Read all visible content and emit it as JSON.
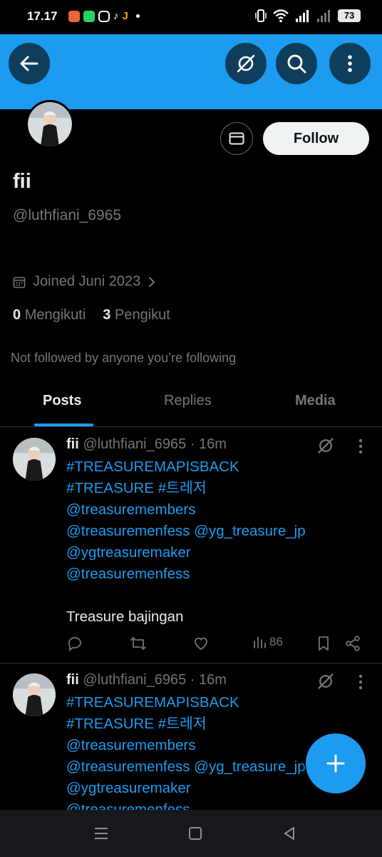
{
  "status_bar": {
    "time": "17.17",
    "battery": "73",
    "app_icon_colors": [
      "#e8663a",
      "#25d366",
      "#ffffff",
      "#ffffff",
      "#f5a623"
    ]
  },
  "profile": {
    "display_name": "fii",
    "handle": "@luthfiani_6965",
    "joined": "Joined Juni 2023",
    "following_count": "0",
    "following_label": "Mengikuti",
    "followers_count": "3",
    "followers_label": "Pengikut",
    "not_followed_text": "Not followed by anyone you’re following",
    "follow_label": "Follow"
  },
  "tabs": [
    {
      "label": "Posts",
      "active": true
    },
    {
      "label": "Replies",
      "active": false
    },
    {
      "label": "Media",
      "active": false
    }
  ],
  "posts": [
    {
      "name": "fii",
      "meta": "@luthfiani_6965 · 16m",
      "lines": [
        "#TREASUREMAPISBACK",
        "#TREASURE #트레저",
        "@treasuremembers",
        "@treasuremenfess @yg_treasure_jp",
        "@ygtreasuremaker",
        "@treasuremenfess",
        "",
        "Treasure bajingan"
      ],
      "views": "86"
    },
    {
      "name": "fii",
      "meta": "@luthfiani_6965 · 16m",
      "lines": [
        "#TREASUREMAPISBACK",
        "#TREASURE #트레저",
        "@treasuremembers",
        "@treasuremenfess @yg_treasure_jp",
        "@ygtreasuremaker",
        "@treasuremenfess"
      ]
    }
  ],
  "icons": {
    "back": "arrow-left-icon",
    "grok": "grok-icon",
    "search": "search-icon",
    "more": "more-vertical-icon",
    "message": "envelope-icon",
    "calendar": "calendar-icon",
    "fab": "plus-icon"
  },
  "colors": {
    "accent": "#1d9bf0",
    "background": "#000000",
    "muted": "#71767b",
    "text": "#e7e9ea"
  }
}
